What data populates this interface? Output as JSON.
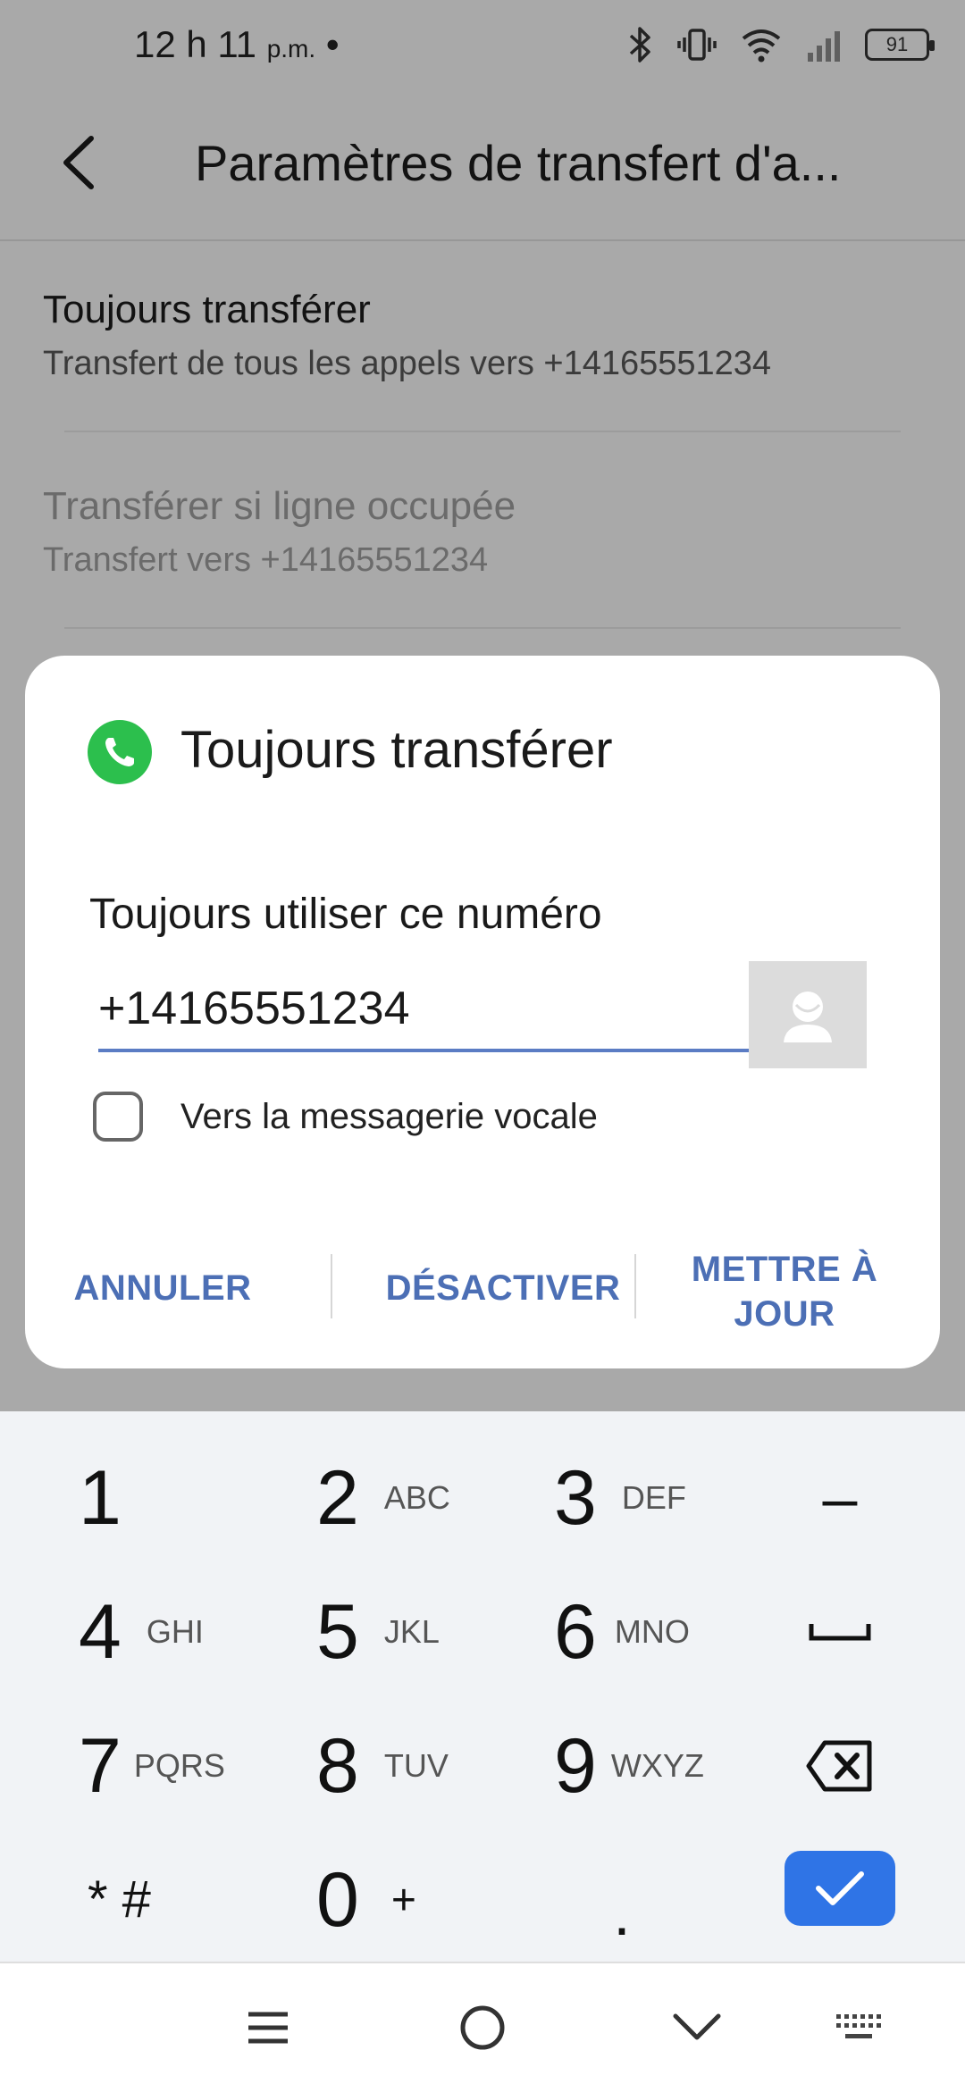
{
  "status_bar": {
    "time": "12 h 11",
    "ampm": "p.m.",
    "dot": "•",
    "battery": "91"
  },
  "header": {
    "title": "Paramètres de transfert d'a..."
  },
  "settings": [
    {
      "title": "Toujours transférer",
      "subtitle": "Transfert de tous les appels vers +14165551234"
    },
    {
      "title": "Transférer si ligne occupée",
      "subtitle": "Transfert vers +14165551234"
    }
  ],
  "dialog": {
    "title": "Toujours transférer",
    "label": "Toujours utiliser ce numéro",
    "phone_value": "+14165551234",
    "checkbox_label": "Vers la messagerie vocale",
    "checkbox_checked": false,
    "buttons": {
      "cancel": "ANNULER",
      "disable": "DÉSACTIVER",
      "update_line1": "METTRE À",
      "update_line2": "JOUR"
    }
  },
  "keypad": {
    "keys": [
      {
        "digit": "1",
        "letters": ""
      },
      {
        "digit": "2",
        "letters": "ABC"
      },
      {
        "digit": "3",
        "letters": "DEF"
      },
      {
        "digit": "–",
        "letters": ""
      },
      {
        "digit": "4",
        "letters": "GHI"
      },
      {
        "digit": "5",
        "letters": "JKL"
      },
      {
        "digit": "6",
        "letters": "MNO"
      },
      {
        "digit": "7",
        "letters": "PQRS"
      },
      {
        "digit": "8",
        "letters": "TUV"
      },
      {
        "digit": "9",
        "letters": "WXYZ"
      },
      {
        "digit": "* #",
        "letters": ""
      },
      {
        "digit": "0",
        "letters": "+"
      },
      {
        "digit": ".",
        "letters": ""
      }
    ]
  },
  "colors": {
    "accent": "#4c6fb5",
    "ok_button": "#2f74e6",
    "phone_icon": "#2cbf4d"
  },
  "icons": {
    "back": "back-arrow-icon",
    "bluetooth": "bluetooth-icon",
    "vibrate": "vibrate-icon",
    "wifi": "wifi-icon",
    "signal": "signal-icon",
    "battery": "battery-icon",
    "phone": "phone-icon",
    "contact": "contact-icon",
    "space": "space-icon",
    "backspace": "backspace-icon",
    "check": "check-icon",
    "menu": "menu-icon",
    "home": "home-icon",
    "hide_keyboard": "chevron-down-icon",
    "keyboard": "keyboard-icon"
  }
}
